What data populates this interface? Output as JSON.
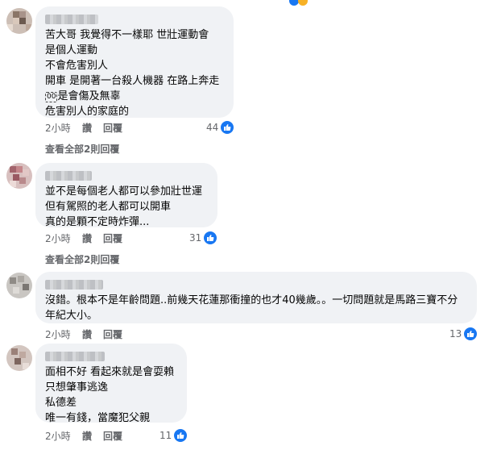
{
  "comments": [
    {
      "lines": [
        "苦大哥 我覺得不一樣耶 世壯運動會",
        "是個人運動",
        "不會危害別人",
        "開車 是開著一台殺人機器 在路上奔走",
        "是會傷及無辜",
        "危害別人的家庭的"
      ],
      "boxed_prefix": "00",
      "time": "2小時",
      "like_label": "讚",
      "reply_label": "回覆",
      "reactions": "44",
      "view_replies": "查看全部2則回覆"
    },
    {
      "lines": [
        "並不是每個老人都可以參加壯世運",
        "但有駕照的老人都可以開車",
        "真的是顆不定時炸彈..."
      ],
      "time": "2小時",
      "like_label": "讚",
      "reply_label": "回覆",
      "reactions": "31",
      "view_replies": "查看全部2則回覆"
    },
    {
      "text": "沒錯。根本不是年齡問題..前幾天花蓮那衝撞的也才40幾歲。。一切問題就是馬路三寶不分年紀大小。",
      "time": "2小時",
      "like_label": "讚",
      "reply_label": "回覆",
      "reactions": "13"
    },
    {
      "lines": [
        "面相不好 看起來就是會耍賴",
        "只想肇事逃逸",
        "私德差",
        "唯一有錢，當魔犯父親"
      ],
      "time": "2小時",
      "like_label": "讚",
      "reply_label": "回覆",
      "reactions": "11"
    }
  ],
  "colors": {
    "bubble": "#f0f2f5",
    "meta": "#65676b",
    "like_blue": "#1877f2"
  },
  "icons": [
    "like-icon",
    "reaction-icon"
  ]
}
